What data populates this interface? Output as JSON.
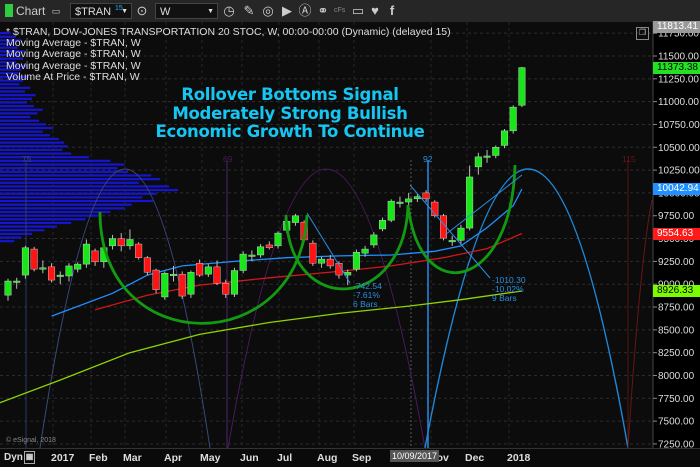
{
  "toolbar": {
    "app_label": "Chart",
    "symbol": "$TRAN",
    "symbol_badge": "15",
    "interval": "W",
    "cfs_label": "cFs"
  },
  "legend": {
    "title": "* $TRAN, DOW-JONES TRANSPORTATION 20 STOC, W, 00:00-00:00 (Dynamic) (delayed 15)",
    "studies": [
      "Moving Average - $TRAN, W",
      "Moving Average - $TRAN, W",
      "Moving Average - $TRAN, W",
      "Volume At Price - $TRAN, W"
    ]
  },
  "annotation": {
    "lines": [
      "Rollover Bottoms Signal",
      "Moderately Strong Bullish",
      "Economic Growth To Continue"
    ],
    "measure1": [
      "-742.54",
      "-7.61%",
      "6 Bars"
    ],
    "measure2": [
      "-1010.30",
      "-10.02%",
      "9 Bars"
    ],
    "cycle_labels": [
      "75",
      "69",
      "92",
      "115"
    ]
  },
  "price_tags": [
    {
      "value": "11813.41",
      "color": "#9a9a9a",
      "text_color": "#ffffff"
    },
    {
      "value": "11373.38",
      "color": "#22e022",
      "text_color": "#000000"
    },
    {
      "value": "10042.94",
      "color": "#1e90ff",
      "text_color": "#ffffff"
    },
    {
      "value": "9554.63",
      "color": "#ff1a1a",
      "text_color": "#ffffff"
    },
    {
      "value": "8926.33",
      "color": "#7cfc00",
      "text_color": "#000000"
    }
  ],
  "footer": {
    "copyright": "© eSignal, 2018",
    "dyn_label": "Dyn",
    "cursor_date": "10/09/2017"
  },
  "chart_data": {
    "type": "candlestick",
    "title": "$TRAN, DOW-JONES TRANSPORTATION 20 STOC, W",
    "x_tick_labels": [
      "2017",
      "Feb",
      "Mar",
      "Apr",
      "May",
      "Jun",
      "Jul",
      "Aug",
      "Sep",
      "Nov",
      "Dec",
      "2018"
    ],
    "y_tick_labels": [
      "11750.00",
      "11500.00",
      "11250.00",
      "11000.00",
      "10750.00",
      "10500.00",
      "10250.00",
      "10000.00",
      "9750.00",
      "9500.00",
      "9250.00",
      "9000.00",
      "8750.00",
      "8500.00",
      "8250.00",
      "8000.00",
      "7750.00",
      "7500.00",
      "7250.00"
    ],
    "ylim": [
      7150,
      11850
    ],
    "grid": true,
    "colors": {
      "up": "#19e619",
      "down": "#ff1414",
      "ma_fast": "#1e90ff",
      "ma_mid": "#d01818",
      "ma_slow": "#8fd400",
      "vap": "#1515d0",
      "arc": "#1a9a1a"
    },
    "candles": [
      [
        8880,
        9060,
        8820,
        9035
      ],
      [
        9030,
        9070,
        8950,
        9035
      ],
      [
        9100,
        9420,
        9060,
        9400
      ],
      [
        9385,
        9410,
        9140,
        9165
      ],
      [
        9180,
        9260,
        9120,
        9180
      ],
      [
        9190,
        9230,
        9020,
        9045
      ],
      [
        9100,
        9140,
        9000,
        9100
      ],
      [
        9090,
        9230,
        9030,
        9200
      ],
      [
        9165,
        9240,
        9130,
        9220
      ],
      [
        9220,
        9490,
        9180,
        9440
      ],
      [
        9365,
        9390,
        9200,
        9245
      ],
      [
        9245,
        9420,
        9180,
        9400
      ],
      [
        9420,
        9540,
        9380,
        9500
      ],
      [
        9500,
        9560,
        9360,
        9420
      ],
      [
        9420,
        9600,
        9380,
        9490
      ],
      [
        9440,
        9460,
        9270,
        9290
      ],
      [
        9290,
        9310,
        9100,
        9130
      ],
      [
        9155,
        9170,
        8900,
        8940
      ],
      [
        8860,
        9140,
        8830,
        9120
      ],
      [
        9110,
        9200,
        9030,
        9110
      ],
      [
        9110,
        9140,
        8840,
        8870
      ],
      [
        8890,
        9150,
        8850,
        9130
      ],
      [
        9230,
        9270,
        9080,
        9100
      ],
      [
        9110,
        9220,
        9080,
        9190
      ],
      [
        9190,
        9260,
        8990,
        9010
      ],
      [
        9010,
        9050,
        8850,
        8890
      ],
      [
        8890,
        9180,
        8860,
        9150
      ],
      [
        9150,
        9360,
        9120,
        9330
      ],
      [
        9320,
        9370,
        9250,
        9320
      ],
      [
        9320,
        9440,
        9290,
        9410
      ],
      [
        9430,
        9470,
        9380,
        9400
      ],
      [
        9420,
        9580,
        9390,
        9560
      ],
      [
        9590,
        9720,
        9560,
        9690
      ],
      [
        9675,
        9770,
        9640,
        9750
      ],
      [
        9680,
        9700,
        9460,
        9485
      ],
      [
        9450,
        9480,
        9200,
        9230
      ],
      [
        9230,
        9300,
        9180,
        9275
      ],
      [
        9275,
        9320,
        9170,
        9200
      ],
      [
        9230,
        9250,
        9060,
        9100
      ],
      [
        9100,
        9160,
        8990,
        9130
      ],
      [
        9165,
        9380,
        9140,
        9350
      ],
      [
        9340,
        9420,
        9300,
        9385
      ],
      [
        9430,
        9570,
        9400,
        9540
      ],
      [
        9605,
        9730,
        9580,
        9700
      ],
      [
        9700,
        9930,
        9680,
        9910
      ],
      [
        9900,
        9960,
        9840,
        9900
      ],
      [
        9900,
        10000,
        9860,
        9935
      ],
      [
        9935,
        9990,
        9900,
        9960
      ],
      [
        10000,
        10030,
        9900,
        9935
      ],
      [
        9900,
        9920,
        9730,
        9750
      ],
      [
        9750,
        9770,
        9480,
        9505
      ],
      [
        9480,
        9530,
        9420,
        9480
      ],
      [
        9480,
        9650,
        9430,
        9615
      ],
      [
        9615,
        10300,
        9590,
        10175
      ],
      [
        10285,
        10440,
        10200,
        10395
      ],
      [
        10405,
        10470,
        10330,
        10405
      ],
      [
        10410,
        10520,
        10380,
        10500
      ],
      [
        10520,
        10700,
        10490,
        10680
      ],
      [
        10680,
        10960,
        10650,
        10940
      ],
      [
        10960,
        11380,
        10940,
        11373
      ]
    ],
    "ma_fast": [
      [
        5,
        8650
      ],
      [
        12,
        8900
      ],
      [
        16,
        9100
      ],
      [
        20,
        9200
      ],
      [
        26,
        9250
      ],
      [
        32,
        9290
      ],
      [
        38,
        9310
      ],
      [
        44,
        9320
      ],
      [
        49,
        9360
      ],
      [
        52,
        9420
      ],
      [
        55,
        9620
      ],
      [
        58,
        9860
      ],
      [
        59,
        10043
      ]
    ],
    "ma_mid": [
      [
        10,
        8720
      ],
      [
        16,
        8880
      ],
      [
        22,
        8990
      ],
      [
        30,
        9070
      ],
      [
        38,
        9140
      ],
      [
        44,
        9200
      ],
      [
        50,
        9290
      ],
      [
        55,
        9390
      ],
      [
        59,
        9555
      ]
    ],
    "ma_slow": [
      [
        -1,
        7700
      ],
      [
        6,
        7950
      ],
      [
        14,
        8250
      ],
      [
        22,
        8450
      ],
      [
        30,
        8580
      ],
      [
        38,
        8680
      ],
      [
        46,
        8760
      ],
      [
        52,
        8830
      ],
      [
        59,
        8926
      ]
    ],
    "volume_at_price": {
      "price_start": 11750,
      "price_step": -40,
      "relative_volume": [
        0.06,
        0.09,
        0.12,
        0.08,
        0.1,
        0.14,
        0.11,
        0.13,
        0.09,
        0.15,
        0.12,
        0.1,
        0.16,
        0.13,
        0.11,
        0.17,
        0.14,
        0.2,
        0.18,
        0.15,
        0.19,
        0.24,
        0.21,
        0.17,
        0.22,
        0.26,
        0.3,
        0.24,
        0.28,
        0.33,
        0.36,
        0.38,
        0.35,
        0.4,
        0.5,
        0.62,
        0.7,
        0.66,
        0.72,
        0.85,
        0.9,
        0.78,
        0.95,
        1.0,
        0.88,
        0.8,
        0.86,
        0.74,
        0.7,
        0.62,
        0.55,
        0.48,
        0.4,
        0.32,
        0.25,
        0.18,
        0.12,
        0.08
      ]
    }
  }
}
